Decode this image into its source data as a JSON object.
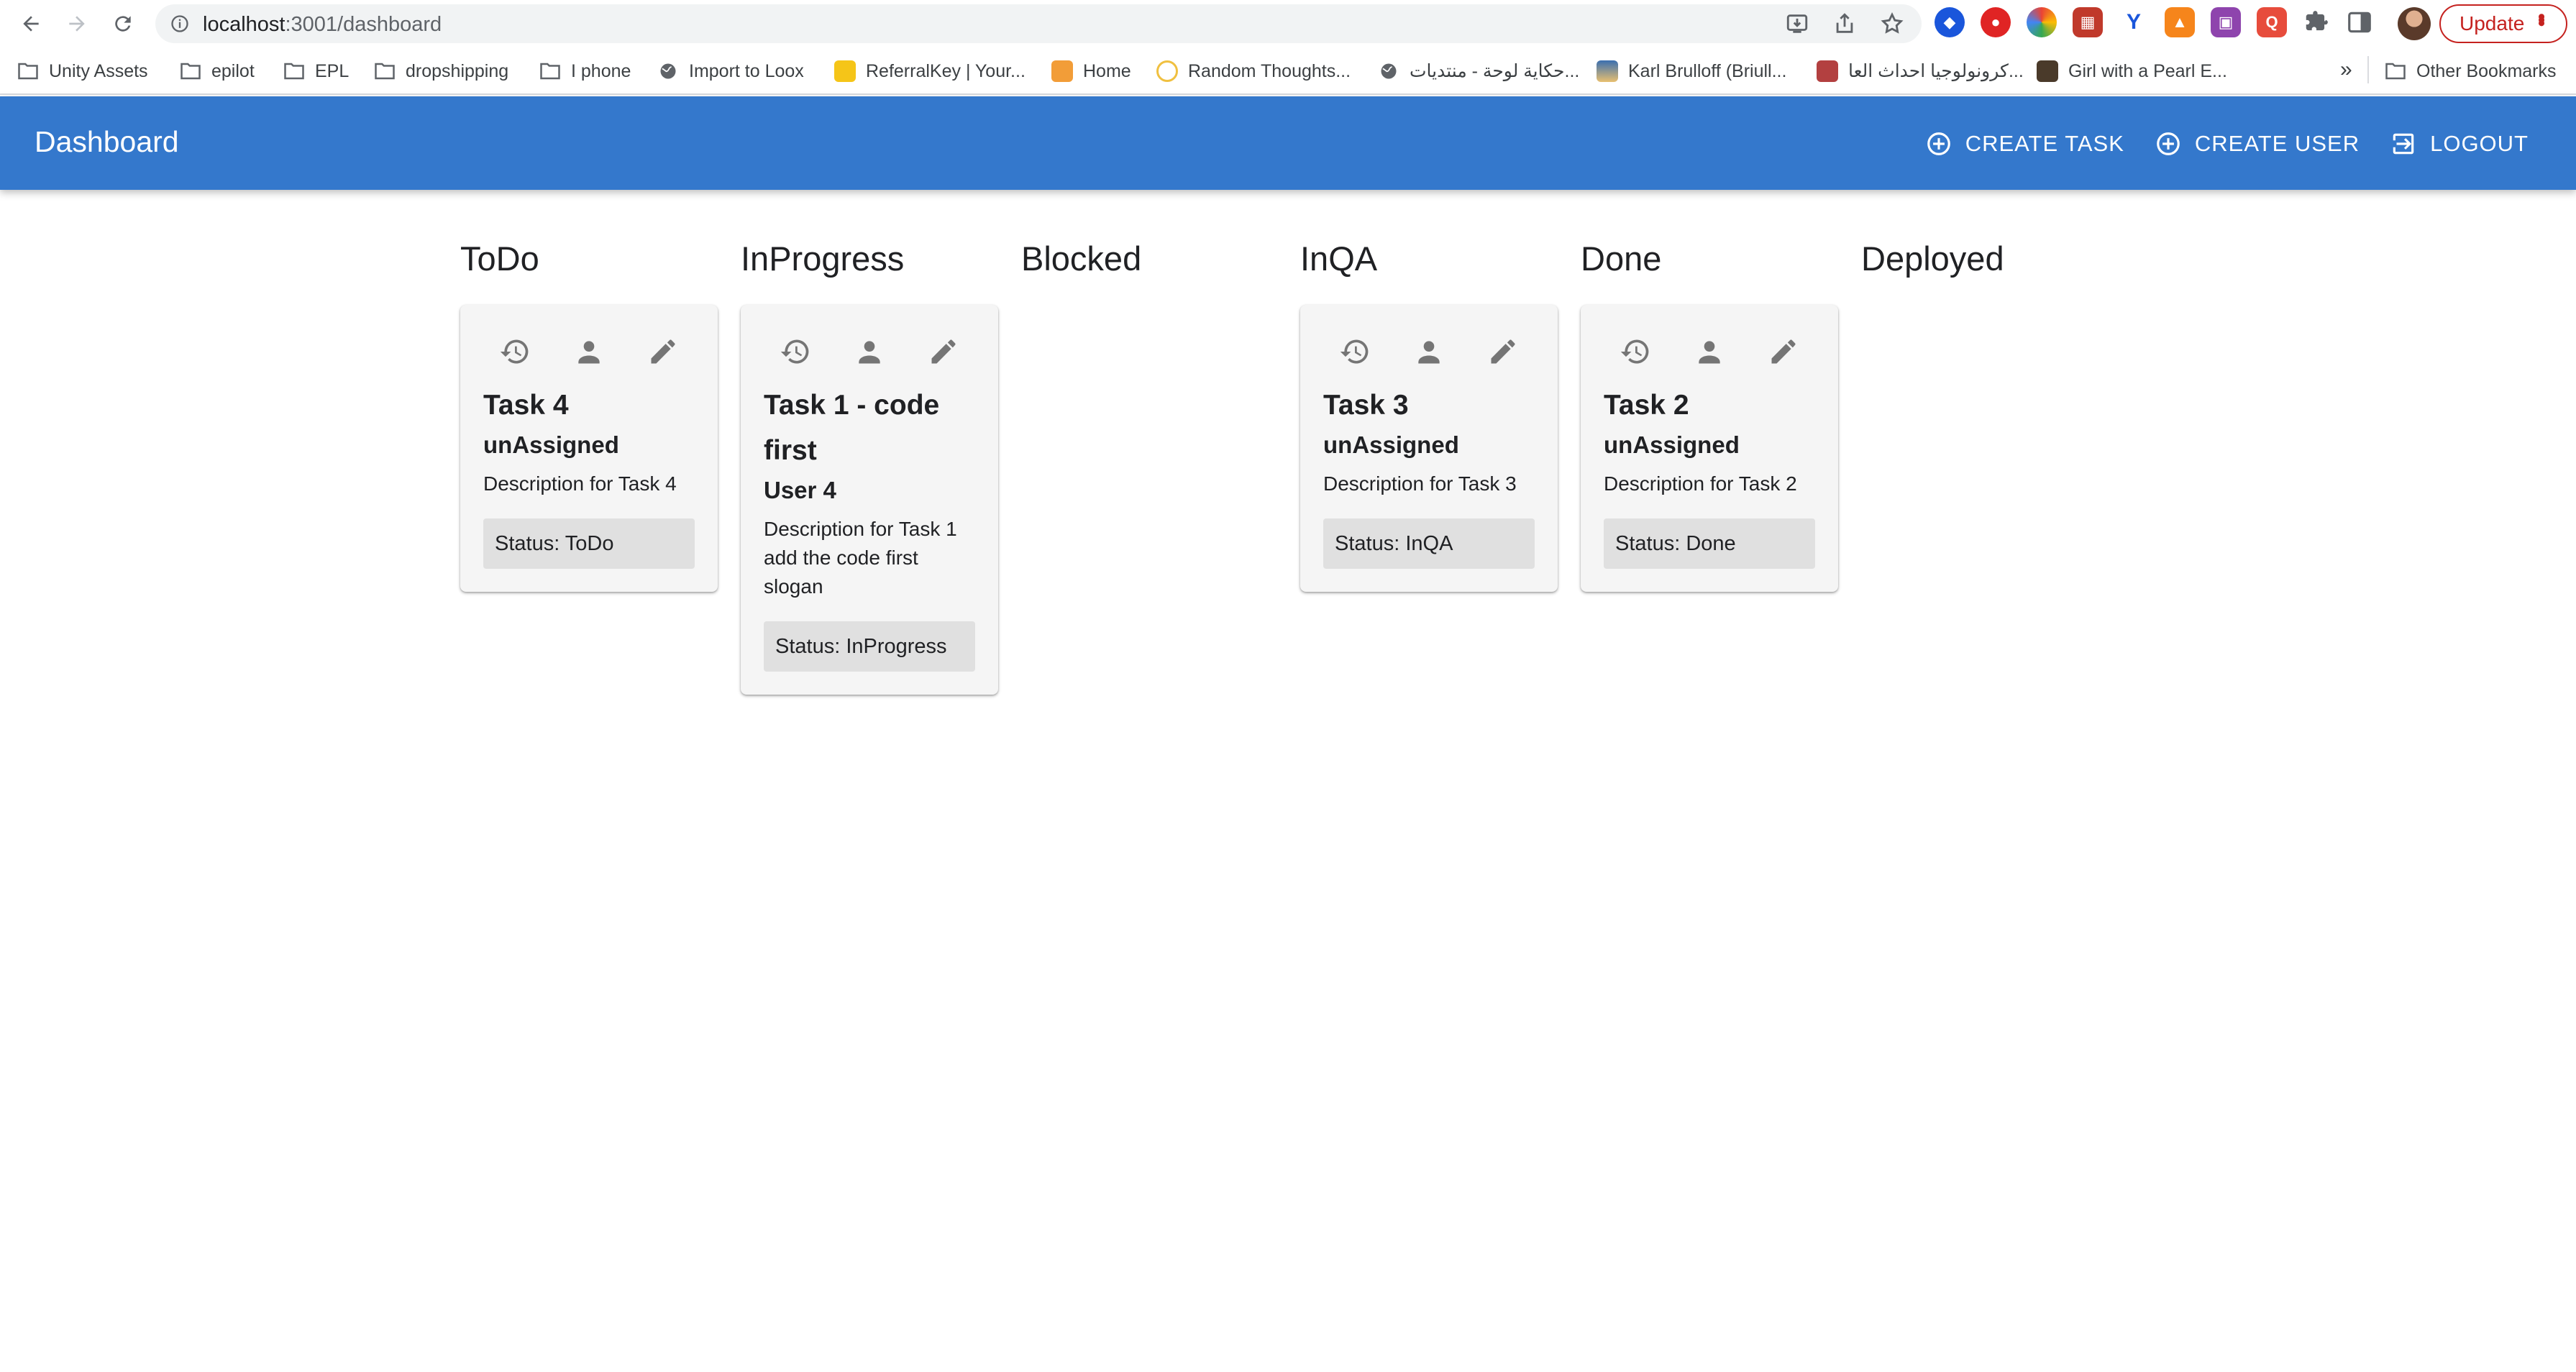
{
  "browser": {
    "url_host": "localhost",
    "url_path": ":3001/dashboard",
    "update_label": "Update",
    "more_bookmarks": "»",
    "bookmarks": [
      {
        "label": "Unity Assets",
        "icon": "folder-icon"
      },
      {
        "label": "epilot",
        "icon": "folder-icon"
      },
      {
        "label": "EPL",
        "icon": "folder-icon"
      },
      {
        "label": "dropshipping",
        "icon": "folder-icon"
      },
      {
        "label": "I phone",
        "icon": "folder-icon"
      },
      {
        "label": "Import to Loox",
        "icon": "globe-icon"
      },
      {
        "label": "ReferralKey | Your...",
        "icon": "favicon"
      },
      {
        "label": "Home",
        "icon": "favicon"
      },
      {
        "label": "Random Thoughts...",
        "icon": "favicon"
      },
      {
        "label": "حكاية لوحة - منتديات...",
        "icon": "globe-icon"
      },
      {
        "label": "Karl Brulloff (Briull...",
        "icon": "favicon"
      },
      {
        "label": "كرونولوجيا احداث العا...",
        "icon": "favicon"
      },
      {
        "label": "Girl with a Pearl E...",
        "icon": "favicon"
      }
    ],
    "other_bookmarks": "Other Bookmarks"
  },
  "appbar": {
    "title": "Dashboard",
    "create_task": "CREATE TASK",
    "create_user": "CREATE USER",
    "logout": "LOGOUT"
  },
  "colors": {
    "appbar": "#3478cc",
    "card": "#f5f5f5",
    "status_chip": "#e0e0e0"
  },
  "columns": [
    {
      "title": "ToDo",
      "card": {
        "title": "Task 4",
        "assignee": "unAssigned",
        "description": "Description for Task 4",
        "status": "Status: ToDo"
      }
    },
    {
      "title": "InProgress",
      "card": {
        "title": "Task 1 - code first",
        "assignee": "User 4",
        "description": "Description for Task 1 add the code first slogan",
        "status": "Status: InProgress"
      }
    },
    {
      "title": "Blocked",
      "card": null
    },
    {
      "title": "InQA",
      "card": {
        "title": "Task 3",
        "assignee": "unAssigned",
        "description": "Description for Task 3",
        "status": "Status: InQA"
      }
    },
    {
      "title": "Done",
      "card": {
        "title": "Task 2",
        "assignee": "unAssigned",
        "description": "Description for Task 2",
        "status": "Status: Done"
      }
    },
    {
      "title": "Deployed",
      "card": null
    }
  ]
}
